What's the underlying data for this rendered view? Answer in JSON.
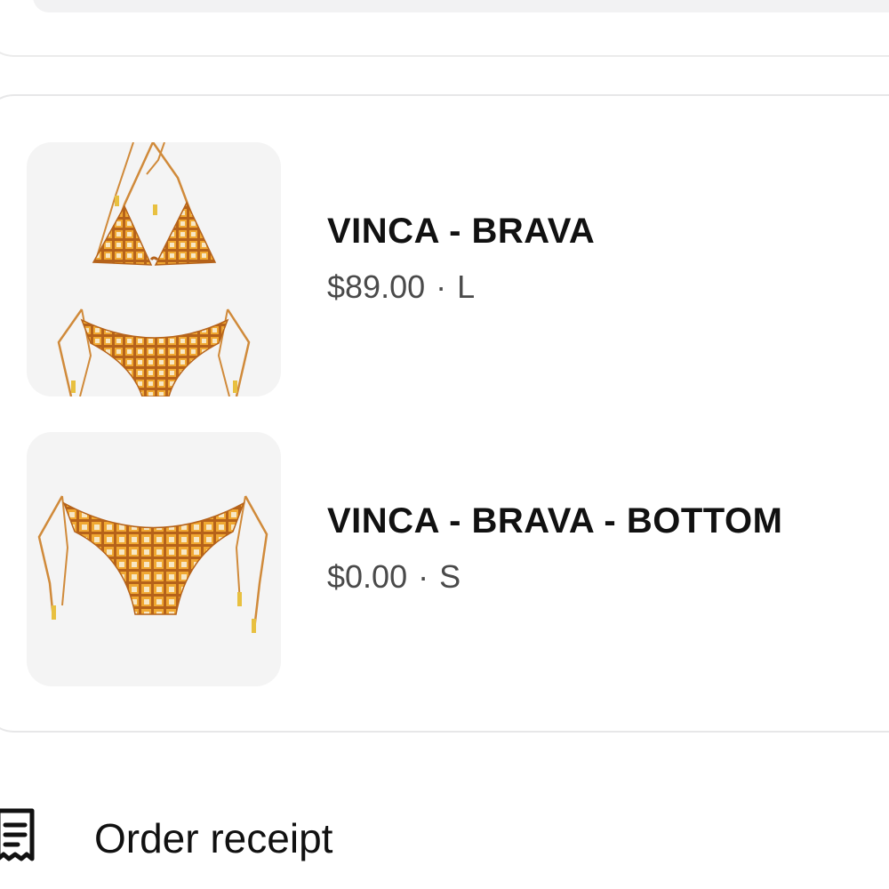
{
  "items": [
    {
      "name": "VINCA - BRAVA",
      "price": "$89.00",
      "separator": "·",
      "size": "L",
      "image_icon": "bikini-set-image",
      "pattern_colors": {
        "base": "#f0a832",
        "grid": "#b5621a",
        "light": "#f7e7c5"
      }
    },
    {
      "name": "VINCA - BRAVA - BOTTOM",
      "price": "$0.00",
      "separator": "·",
      "size": "S",
      "image_icon": "bikini-bottom-image",
      "pattern_colors": {
        "base": "#f0a832",
        "grid": "#b5621a",
        "light": "#f7e7c5"
      }
    }
  ],
  "receipt": {
    "label": "Order receipt",
    "icon": "receipt-icon"
  }
}
